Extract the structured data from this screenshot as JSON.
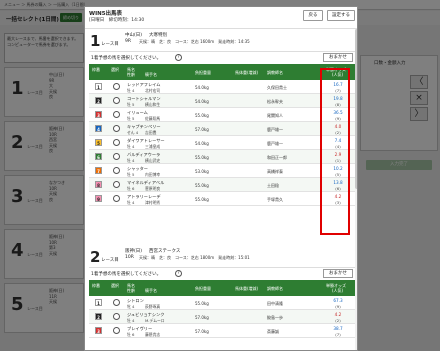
{
  "background": {
    "top_bar_text": "メニュー ＞ 馬券の購入 ＞ 一括購入（1日間）",
    "page_title": "一括セレクト(1日間)",
    "title_btn": "締め切り",
    "left_info": "最大レースまで、馬番を選択できます。\nコンピューターで馬券を選びます。",
    "races": [
      {
        "num": "1",
        "label": "レース目",
        "info": "中山(日)\n9R\n大\n天候\n良"
      },
      {
        "num": "2",
        "label": "レース目",
        "info": "阪神(日)\n10R\n西宮\n天候\n良"
      },
      {
        "num": "3",
        "label": "レース目",
        "info": "なかつき\n10R\n天候\n良"
      },
      {
        "num": "4",
        "label": "レース目",
        "info": "阪神(日)\n10R\n第3\n天候"
      },
      {
        "num": "5",
        "label": "レース目",
        "info": "阪神(日)\n11R\n天候"
      }
    ],
    "right_header": "口数・金額入力",
    "right_btn": "入力完了",
    "arrows": [
      "〈",
      "×",
      "〉"
    ]
  },
  "modal": {
    "title": "WIN5出馬表",
    "deadline": "[日曜日　締切時刻：14:30",
    "back_btn": "戻る",
    "settings_btn": "設定する",
    "select_text": "1着予想の馬を選択してください。",
    "help": "?",
    "omakase_btn": "おまかせ",
    "headers": {
      "frame": "枠番",
      "select": "選択",
      "horse_line1": "馬名",
      "horse_line2": "性齢",
      "jockey": "騎手名",
      "weight": "負担重量",
      "prev_weight": "馬体重(増減)",
      "trainer": "調教師名",
      "odds_line1": "単勝オッズ",
      "odds_line2": "(人気)"
    },
    "race1": {
      "num": "1",
      "label": "レース目",
      "venue": "中山(日)",
      "rnum": "9R",
      "name": "大寒特別",
      "detail": "天候：晴　芝：良　コース：芝右 1600m　発走時刻：14:35",
      "horses": [
        {
          "num": "1",
          "color": "#ffffff",
          "text": "#222222",
          "name": "レッドアフレイム",
          "sex": "牡 4",
          "jockey": "北村宏司",
          "weight": "54.0kg",
          "trainer": "久保田貴士",
          "odds": "16.7",
          "pop": "(7)",
          "hot": false
        },
        {
          "num": "2",
          "color": "#222222",
          "text": "#ffffff",
          "name": "コートシャルマン",
          "sex": "牡 5",
          "jockey": "横山和生",
          "weight": "54.0kg",
          "trainer": "松永幹夫",
          "odds": "19.8",
          "pop": "(8)",
          "hot": false
        },
        {
          "num": "3",
          "color": "#d32f2f",
          "text": "#ffffff",
          "name": "イリューム",
          "sex": "牡 5",
          "jockey": "佐藤翔馬",
          "weight": "55.0kg",
          "trainer": "尾関知人",
          "odds": "36.5",
          "pop": "(9)",
          "hot": false
        },
        {
          "num": "4",
          "color": "#1565c0",
          "text": "#ffffff",
          "name": "キャプテンペリー",
          "sex": "せん 4",
          "jockey": "吉田豊",
          "weight": "57.0kg",
          "trainer": "鹿戸雄一",
          "odds": "4.0",
          "pop": "(2)",
          "hot": true
        },
        {
          "num": "5",
          "color": "#fbc02d",
          "text": "#222222",
          "name": "ダイワアトレーサー",
          "sex": "牡 4",
          "jockey": "三浦皇成",
          "weight": "54.0kg",
          "trainer": "鹿戸雄一",
          "odds": "7.4",
          "pop": "(4)",
          "hot": false
        },
        {
          "num": "6",
          "color": "#2e7d32",
          "text": "#ffffff",
          "name": "バルディアウーラ",
          "sex": "牡 4",
          "jockey": "横山武史",
          "weight": "55.0kg",
          "trainer": "和田正一郎",
          "odds": "2.9",
          "pop": "(1)",
          "hot": true
        },
        {
          "num": "7",
          "color": "#ef6c00",
          "text": "#ffffff",
          "name": "シャッター",
          "sex": "牡 5",
          "jockey": "内田博幸",
          "weight": "53.0kg",
          "trainer": "高橋祥泰",
          "odds": "10.2",
          "pop": "(5)",
          "hot": false
        },
        {
          "num": "8",
          "color": "#f48fb1",
          "text": "#222222",
          "name": "マイネルディアベル",
          "sex": "牡 6",
          "jockey": "菅原明良",
          "weight": "55.0kg",
          "trainer": "土田稔",
          "odds": "13.8",
          "pop": "(6)",
          "hot": false
        },
        {
          "num": "9",
          "color": "#f48fb1",
          "text": "#222222",
          "name": "アトラリーレーデ",
          "sex": "牡 4",
          "jockey": "津村明秀",
          "weight": "55.0kg",
          "trainer": "手塚貴久",
          "odds": "4.2",
          "pop": "(3)",
          "hot": true
        }
      ]
    },
    "race2": {
      "num": "2",
      "label": "レース目",
      "venue": "阪神(日)",
      "rnum": "10R",
      "name": "西宮ステークス",
      "detail": "天候：晴　芝：良　コース：芝右 1800m　発走時刻：15:01",
      "horses": [
        {
          "num": "1",
          "color": "#ffffff",
          "text": "#222222",
          "name": "シトロン",
          "sex": "牝 4",
          "jockey": "荻野琢真",
          "weight": "55.0kg",
          "trainer": "田中清隆",
          "odds": "67.3",
          "pop": "(9)",
          "hot": false
        },
        {
          "num": "2",
          "color": "#222222",
          "text": "#ffffff",
          "name": "ジュビリョナシンク",
          "sex": "牡 4",
          "jockey": "M.デムーロ",
          "weight": "57.0kg",
          "trainer": "鮫島一歩",
          "odds": "4.2",
          "pop": "(2)",
          "hot": true
        },
        {
          "num": "3",
          "color": "#d32f2f",
          "text": "#ffffff",
          "name": "ブレイヴリー",
          "sex": "牡 6",
          "jockey": "藤懸貴志",
          "weight": "57.0kg",
          "trainer": "斎藤誠",
          "odds": "38.7",
          "pop": "(7)",
          "hot": false
        }
      ]
    }
  }
}
